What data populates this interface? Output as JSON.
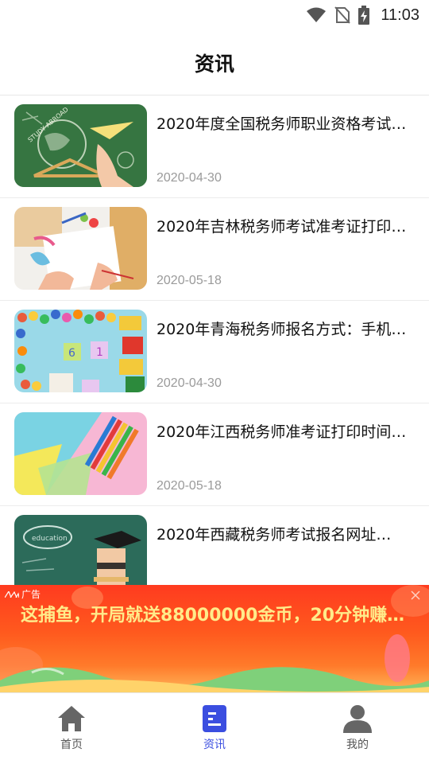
{
  "status_bar": {
    "time": "11:03",
    "icons": [
      "wifi-icon",
      "no-sim-icon",
      "battery-charging-icon"
    ]
  },
  "header": {
    "title": "资讯"
  },
  "news": [
    {
      "title": "2020年度全国税务师职业资格考试…",
      "date": "2020-04-30",
      "thumb": "chalkboard-paper-plane"
    },
    {
      "title": "2020年吉林税务师考试准考证打印…",
      "date": "2020-05-18",
      "thumb": "kids-drawing"
    },
    {
      "title": "2020年青海税务师报名方式：手机…",
      "date": "2020-04-30",
      "thumb": "candy-blocks"
    },
    {
      "title": "2020年江西税务师准考证打印时间…",
      "date": "2020-05-18",
      "thumb": "colored-pencils"
    },
    {
      "title": "2020年西藏税务师考试报名网址…",
      "date": "",
      "thumb": "graduate-education"
    }
  ],
  "ad": {
    "label": "广告",
    "text": "这捕鱼，开局就送88000000金币，20分钟赚…",
    "close_icon": "close-icon"
  },
  "nav": [
    {
      "label": "首页",
      "icon": "home-icon",
      "active": false
    },
    {
      "label": "资讯",
      "icon": "news-icon",
      "active": true,
      "color": "#3b4ee0"
    },
    {
      "label": "我的",
      "icon": "user-icon",
      "active": false
    }
  ],
  "colors": {
    "accent": "#3b4ee0",
    "ad_background": "#ff4a1e",
    "ad_text": "#ffeb8a",
    "date_text": "#9a9a9a"
  }
}
